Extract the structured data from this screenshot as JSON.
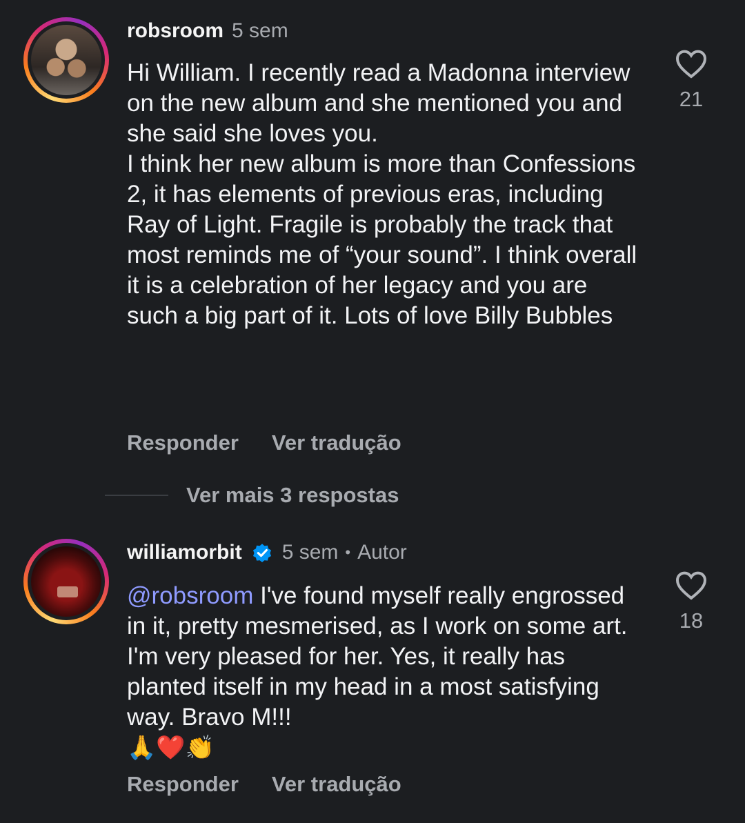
{
  "comments": [
    {
      "username": "robsroom",
      "time": "5 sem",
      "verified": false,
      "author_tag": "",
      "mention": "",
      "paragraphs": [
        "Hi William. I recently read a Madonna interview on the new album and she mentioned you and she said she loves you.",
        "I think her new album is more than Confessions 2, it has elements of previous eras, including Ray of Light. Fragile is probably the track that most reminds me of “your sound”. I think overall it is a celebration of her legacy and you are such a big part of it. Lots of love Billy Bubbles"
      ],
      "likes": "21",
      "reply_label": "Responder",
      "translate_label": "Ver tradução"
    },
    {
      "username": "williamorbit",
      "time": "5 sem",
      "verified": true,
      "author_tag": "Autor",
      "mention": "@robsroom",
      "text": " I've found myself really engrossed in it, pretty mesmerised, as I work on some art. I'm very pleased for her. Yes, it really has planted itself in my head in a most satisfying way. Bravo M!!!",
      "emojis": "🙏❤️👏",
      "likes": "18",
      "reply_label": "Responder",
      "translate_label": "Ver tradução"
    }
  ],
  "more_replies": "Ver mais 3 respostas",
  "colors": {
    "background": "#1c1e21",
    "mention": "#8f9bff",
    "verified": "#0095f6",
    "muted": "#a8abb0"
  },
  "icons": {
    "like": "heart-outline-icon",
    "verified": "verified-badge-icon"
  }
}
